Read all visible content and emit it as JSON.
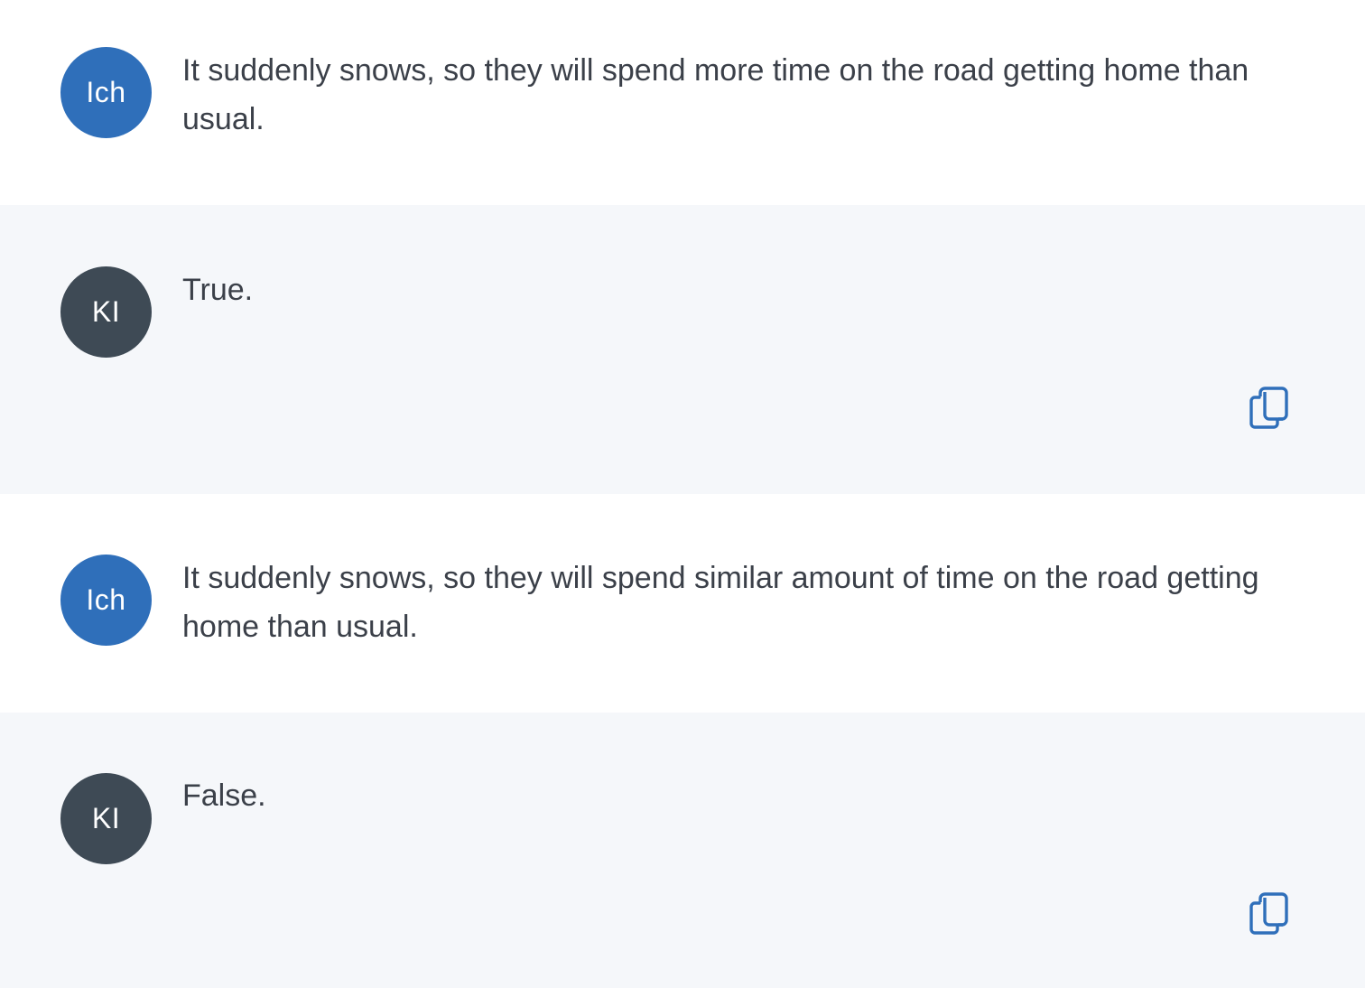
{
  "colors": {
    "user_avatar": "#2f6fba",
    "ai_avatar": "#3e4a55",
    "ai_background": "#f5f7fa",
    "copy_icon": "#2f6fba",
    "text": "#3b4049"
  },
  "messages": [
    {
      "role": "user",
      "avatar_label": "Ich",
      "text": "It suddenly snows, so they will spend more time on the road getting home than usual."
    },
    {
      "role": "ai",
      "avatar_label": "KI",
      "text": "True.",
      "action_icon": "copy-icon"
    },
    {
      "role": "user",
      "avatar_label": "Ich",
      "text": "It suddenly snows, so they will spend similar amount of time on the road getting home than usual."
    },
    {
      "role": "ai",
      "avatar_label": "KI",
      "text": "False.",
      "action_icon": "copy-icon"
    }
  ]
}
